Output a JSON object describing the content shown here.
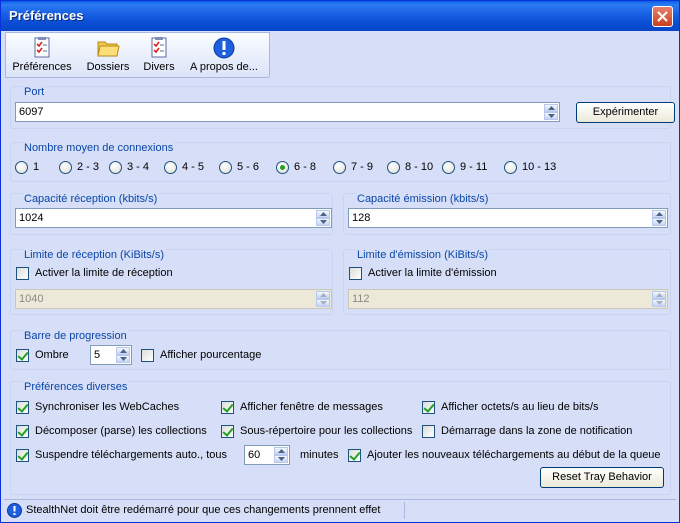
{
  "window": {
    "title": "Préférences"
  },
  "toolbar": [
    {
      "label": "Préférences"
    },
    {
      "label": "Dossiers"
    },
    {
      "label": "Divers"
    },
    {
      "label": "A propos de..."
    }
  ],
  "port": {
    "title": "Port",
    "value": "6097",
    "button": "Expérimenter"
  },
  "connections": {
    "title": "Nombre moyen de connexions",
    "options": [
      "1",
      "2 - 3",
      "3 - 4",
      "4 - 5",
      "5 - 6",
      "6 - 8",
      "7 - 9",
      "8 - 10",
      "9 - 11",
      "10 - 13"
    ],
    "selected": "6 - 8"
  },
  "capacity": {
    "reception": {
      "title": "Capacité réception (kbits/s)",
      "value": "1024"
    },
    "emission": {
      "title": "Capacité émission (kbits/s)",
      "value": "128"
    }
  },
  "limits": {
    "reception": {
      "title": "Limite de réception (KiBits/s)",
      "checkbox": "Activer la limite de réception",
      "checked": false,
      "value": "1040"
    },
    "emission": {
      "title": "Limite d'émission (KiBits/s)",
      "checkbox": "Activer la limite d'émission",
      "checked": false,
      "value": "112"
    }
  },
  "progress": {
    "title": "Barre de progression",
    "shadow": {
      "label": "Ombre",
      "checked": true
    },
    "shadow_value": "5",
    "percent": {
      "label": "Afficher pourcentage",
      "checked": false
    }
  },
  "misc": {
    "title": "Préférences diverses",
    "sync_webcaches": {
      "label": "Synchroniser les WebCaches",
      "checked": true
    },
    "show_messages": {
      "label": "Afficher fenêtre de messages",
      "checked": true
    },
    "bytes_per_sec": {
      "label": "Afficher octets/s au lieu de bits/s",
      "checked": true
    },
    "parse_collections": {
      "label": "Décomposer (parse) les collections",
      "checked": true
    },
    "subfolder_collections": {
      "label": "Sous-répertoire pour les collections",
      "checked": true
    },
    "start_tray": {
      "label": "Démarrage dans la zone de notification",
      "checked": false
    },
    "suspend_downloads": {
      "label": "Suspendre téléchargements auto., tous",
      "checked": true
    },
    "suspend_value": "60",
    "minutes_label": "minutes",
    "add_new_top": {
      "label": "Ajouter les nouveaux téléchargements au début de la queue",
      "checked": true
    },
    "reset_button": "Reset Tray Behavior"
  },
  "status": {
    "text": "StealthNet doit être redémarré pour que ces changements prennent effet"
  },
  "colors": {
    "group_title": "#0a46a8",
    "background": "#d6dff7",
    "titlebar": "#0a4fd6",
    "check_green": "#21a121"
  }
}
